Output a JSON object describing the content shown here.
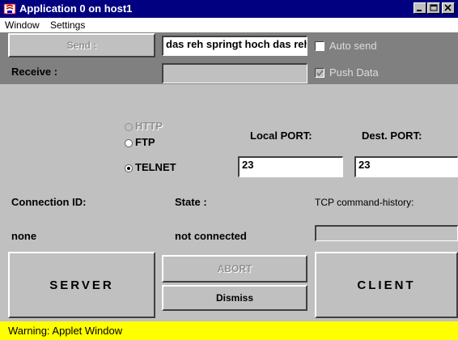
{
  "window": {
    "title": "Application 0 on host1",
    "icon": "java-app-icon",
    "controls": [
      "minimize-icon",
      "maximize-icon",
      "close-icon"
    ]
  },
  "menubar": {
    "items": [
      "Window",
      "Settings"
    ]
  },
  "send": {
    "button_label": "Send :",
    "input_value": "das reh springt hoch das reh",
    "auto_send_label": "Auto send",
    "auto_send_checked": false
  },
  "receive": {
    "label": "Receive :",
    "input_value": "",
    "push_data_label": "Push Data",
    "push_data_checked": true
  },
  "protocol": {
    "options": [
      "HTTP",
      "FTP",
      "TELNET"
    ],
    "selected": "TELNET"
  },
  "ports": {
    "local_label": "Local  PORT:",
    "local_value": "23",
    "dest_label": "Dest.  PORT:",
    "dest_value": "23"
  },
  "connection": {
    "id_label": "Connection ID:",
    "id_value": "none",
    "state_label": "State :",
    "state_value": "not connected",
    "history_label": "TCP command-history:"
  },
  "actions": {
    "server_label": "SERVER",
    "abort_label": "ABORT",
    "dismiss_label": "Dismiss",
    "client_label": "CLIENT"
  },
  "status": {
    "text": "Warning: Applet Window",
    "color": "#ffff00"
  },
  "colors": {
    "titlebar": "#000080",
    "panel": "#c0c0c0",
    "dark_panel": "#808080"
  }
}
